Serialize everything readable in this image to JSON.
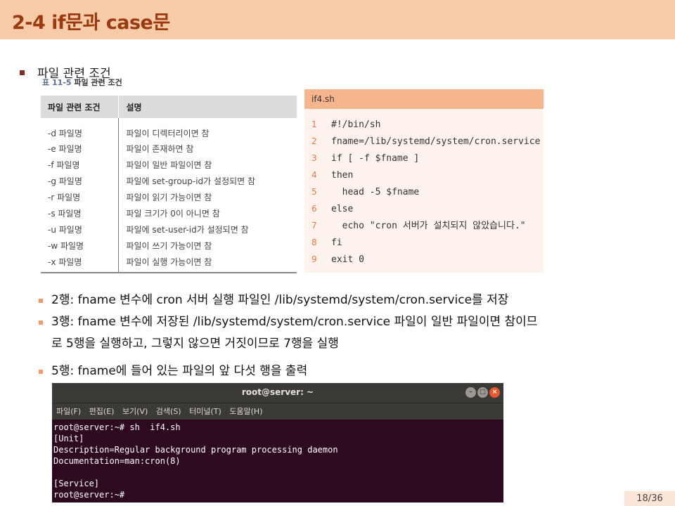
{
  "title": "2-4 if문과 case문",
  "main_bullet": "파일 관련 조건",
  "table": {
    "caption_no": "표 11-5",
    "caption_text": "파일 관련 조건",
    "headers": [
      "파일 관련 조건",
      "설명"
    ],
    "rows": [
      [
        "-d 파일명",
        "파일이 디렉터리이면 참"
      ],
      [
        "-e 파일명",
        "파일이 존재하면 참"
      ],
      [
        "-f 파일명",
        "파일이 일반 파일이면 참"
      ],
      [
        "-g 파일명",
        "파일에 set-group-id가 설정되면 참"
      ],
      [
        "-r 파일명",
        "파일이 읽기 가능이면 참"
      ],
      [
        "-s 파일명",
        "파일 크기가 0이 아니면 참"
      ],
      [
        "-u 파일명",
        "파일에 set-user-id가 설정되면 참"
      ],
      [
        "-w 파일명",
        "파일이 쓰기 가능이면 참"
      ],
      [
        "-x 파일명",
        "파일이 실행 가능이면 참"
      ]
    ]
  },
  "code": {
    "filename": "if4.sh",
    "lines": [
      {
        "n": "1",
        "text": "#!/bin/sh"
      },
      {
        "n": "2",
        "text": "fname=/lib/systemd/system/cron.service"
      },
      {
        "n": "3",
        "text": "if [ -f $fname ]"
      },
      {
        "n": "4",
        "text": "then"
      },
      {
        "n": "5",
        "text": "  head -5 $fname"
      },
      {
        "n": "6",
        "text": "else"
      },
      {
        "n": "7",
        "text": "  echo \"cron 서버가 설치되지 않았습니다.\""
      },
      {
        "n": "8",
        "text": "fi"
      },
      {
        "n": "9",
        "text": "exit 0"
      }
    ]
  },
  "bullets": [
    "2행: fname 변수에 cron 서버 실행 파일인 /lib/systemd/system/cron.service를 저장",
    "3행: fname 변수에 저장된 /lib/systemd/system/cron.service 파일이 일반 파일이면 참이므",
    "로 5행을 실행하고, 그렇지 않으면 거짓이므로 7행을 실행",
    "5행: fname에 들어 있는 파일의 앞 다섯 행을 출력"
  ],
  "terminal": {
    "title": "root@server: ~",
    "menu": [
      "파일(F)",
      "편집(E)",
      "보기(V)",
      "검색(S)",
      "터미널(T)",
      "도움말(H)"
    ],
    "lines": [
      "root@server:~# sh  if4.sh",
      "[Unit]",
      "Description=Regular background program processing daemon",
      "Documentation=man:cron(8)",
      "",
      "[Service]",
      "root@server:~#"
    ]
  },
  "page_number": "18/36",
  "colors": {
    "title_bar": "#f8cba8",
    "title_text": "#9a3a10",
    "code_header": "#f6b58c",
    "code_bg": "#fdf3ec",
    "line_number": "#e07b4a",
    "terminal_bg": "#2e0a20"
  }
}
